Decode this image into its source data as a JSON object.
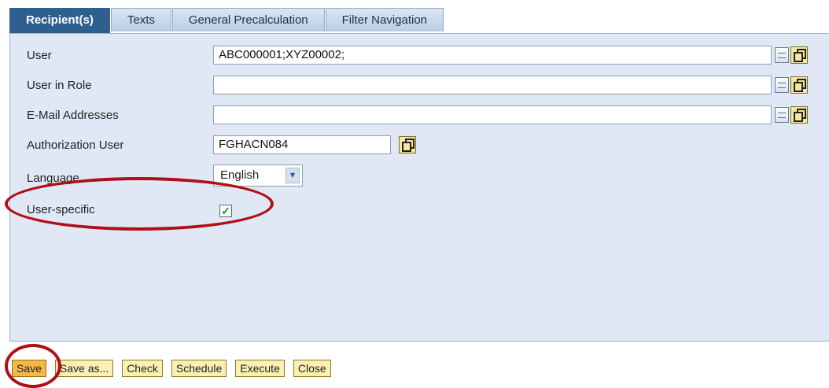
{
  "tabs": [
    {
      "label": "Recipient(s)",
      "active": true
    },
    {
      "label": "Texts"
    },
    {
      "label": "General Precalculation"
    },
    {
      "label": "Filter Navigation"
    }
  ],
  "form": {
    "user": {
      "label": "User",
      "value": "ABC000001;XYZ00002;"
    },
    "user_in_role": {
      "label": "User in Role",
      "value": ""
    },
    "email_addresses": {
      "label": "E-Mail Addresses",
      "value": ""
    },
    "authorization_user": {
      "label": "Authorization User",
      "value": "FGHACN084"
    },
    "language": {
      "label": "Language",
      "value": "English"
    },
    "user_specific": {
      "label": "User-specific",
      "checked": true,
      "check_glyph": "✓"
    }
  },
  "buttons": {
    "save": "Save",
    "save_as": "Save as...",
    "check": "Check",
    "schedule": "Schedule",
    "execute": "Execute",
    "close": "Close"
  },
  "colors": {
    "panel": "#dfe8f4",
    "active_tab": "#2f5f8f",
    "button": "#fbf0b2",
    "annotation": "#b00f16"
  },
  "icons": {
    "spin": "multi-select-icon",
    "copy": "value-help-icon",
    "select_arrow": "chevron-down-icon"
  }
}
